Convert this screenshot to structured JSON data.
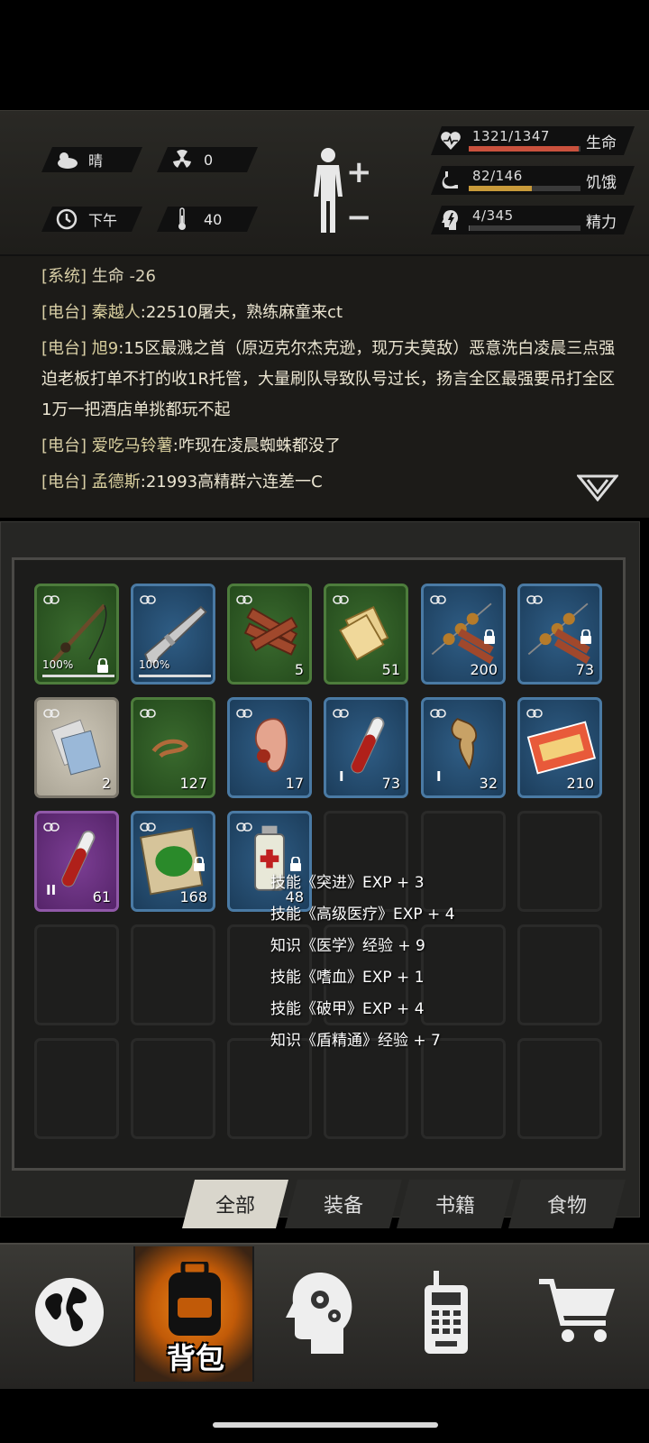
{
  "status": {
    "weather": "晴",
    "radiation": "0",
    "time_of_day": "下午",
    "temperature": "40",
    "stats": [
      {
        "id": "life",
        "value": "1321/1347",
        "label": "生命",
        "fraction": 0.981,
        "color": "#c9513d"
      },
      {
        "id": "hunger",
        "value": "82/146",
        "label": "饥饿",
        "fraction": 0.562,
        "color": "#c89a3a"
      },
      {
        "id": "energy",
        "value": "4/345",
        "label": "精力",
        "fraction": 0.012,
        "color": "#777"
      }
    ]
  },
  "log": [
    {
      "tag": "[系统]",
      "text": "生命 -26"
    },
    {
      "tag": "[电台]",
      "name": "秦越人",
      "text": ":22510屠夫，熟练麻童来ct"
    },
    {
      "tag": "[电台]",
      "name": "旭9",
      "text": ":15区最溅之首（原迈克尔杰克逊，现万夫莫敌）恶意洗白凌晨三点强迫老板打单不打的收1R托管，大量刷队导致队号过长，扬言全区最强要吊打全区1万一把酒店单挑都玩不起"
    },
    {
      "tag": "[电台]",
      "name": "爱吃马铃薯",
      "text": ":咋现在凌晨蜘蛛都没了"
    },
    {
      "tag": "[电台]",
      "name": "孟德斯",
      "text": ":21993高精群六连差一C"
    }
  ],
  "inventory": {
    "rows": [
      [
        {
          "rarity": "green",
          "icon": "fishing-rod-icon",
          "durability": "100%",
          "locked": true
        },
        {
          "rarity": "blue",
          "icon": "rifle-icon",
          "durability": "100%",
          "locked": false
        },
        {
          "rarity": "green",
          "icon": "firewood-icon",
          "count": "5"
        },
        {
          "rarity": "green",
          "icon": "crackers-icon",
          "count": "51"
        },
        {
          "rarity": "blue",
          "icon": "skewer-meat-icon",
          "count": "200",
          "locked": true
        },
        {
          "rarity": "blue",
          "icon": "skewer-meat-icon",
          "count": "73",
          "locked": true
        }
      ],
      [
        {
          "rarity": "gray",
          "icon": "paper-icon",
          "count": "2"
        },
        {
          "rarity": "green",
          "icon": "worm-icon",
          "count": "127"
        },
        {
          "rarity": "blue",
          "icon": "ear-icon",
          "count": "17"
        },
        {
          "rarity": "blue",
          "icon": "blood-vial-icon",
          "count": "73",
          "tier": "I"
        },
        {
          "rarity": "blue",
          "icon": "claw-icon",
          "count": "32",
          "tier": "I"
        },
        {
          "rarity": "blue",
          "icon": "ticket-icon",
          "count": "210"
        }
      ],
      [
        {
          "rarity": "purple",
          "icon": "blood-vial-icon",
          "count": "61",
          "tier": "II"
        },
        {
          "rarity": "blue",
          "icon": "herb-map-icon",
          "count": "168",
          "locked": true
        },
        {
          "rarity": "blue",
          "icon": "medicine-bottle-icon",
          "count": "48",
          "locked": true
        },
        {
          "rarity": "empty"
        },
        {
          "rarity": "empty"
        },
        {
          "rarity": "empty"
        }
      ],
      [
        {
          "rarity": "empty"
        },
        {
          "rarity": "empty"
        },
        {
          "rarity": "empty"
        },
        {
          "rarity": "empty"
        },
        {
          "rarity": "empty"
        },
        {
          "rarity": "empty"
        }
      ],
      [
        {
          "rarity": "empty"
        },
        {
          "rarity": "empty"
        },
        {
          "rarity": "empty"
        },
        {
          "rarity": "empty"
        },
        {
          "rarity": "empty"
        },
        {
          "rarity": "empty"
        }
      ]
    ]
  },
  "exp_popup": [
    "技能《突进》EXP + 3",
    "技能《高级医疗》EXP + 4",
    "知识《医学》经验 + 9",
    "技能《嗜血》EXP + 1",
    "技能《破甲》EXP + 4",
    "知识《盾精通》经验 + 7"
  ],
  "tabs": [
    "全部",
    "装备",
    "书籍",
    "食物"
  ],
  "nav": {
    "bag_label": "背包",
    "items": [
      "globe-icon",
      "backpack-icon",
      "brain-gear-icon",
      "radio-icon",
      "cart-icon"
    ]
  }
}
